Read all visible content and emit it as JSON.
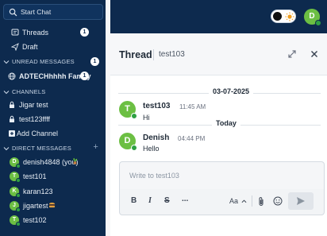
{
  "sidebar": {
    "search_placeholder": "Start Chat",
    "threads": {
      "label": "Threads",
      "badge": "1"
    },
    "draft": {
      "label": "Draft"
    },
    "unread_section": {
      "label": "UNREAD MESSAGES",
      "badge": "1"
    },
    "unread_items": [
      {
        "label": "ADTECHhhhh Family",
        "badge": "1"
      }
    ],
    "channels_section": {
      "label": "CHANNELS"
    },
    "channels": [
      {
        "label": "Jigar test"
      },
      {
        "label": "test123ffff"
      }
    ],
    "add_channel_label": "Add Channel",
    "dm_section": {
      "label": "DIRECT MESSAGES",
      "add": "+"
    },
    "direct_messages": [
      {
        "initial": "D",
        "label": "denish4848 (you)"
      },
      {
        "initial": "T",
        "label": "test101"
      },
      {
        "initial": "K",
        "label": "karan123"
      },
      {
        "initial": "J",
        "label": "jigartest"
      },
      {
        "initial": "T",
        "label": "test102"
      }
    ]
  },
  "header": {
    "user_initial": "D"
  },
  "thread": {
    "title": "Thread",
    "channel": "test103",
    "date_divider_1": "03-07-2025",
    "date_divider_2": "Today",
    "messages": [
      {
        "initial": "T",
        "name": "test103",
        "time": "11:45 AM",
        "text": "Hi"
      },
      {
        "initial": "D",
        "name": "Denish",
        "time": "04:44 PM",
        "text": "Hello"
      }
    ],
    "composer_placeholder": "Write to test103",
    "toolbar": {
      "bold": "B",
      "italic": "I",
      "strike": "S",
      "more": "...",
      "font": "Aa"
    }
  },
  "colors": {
    "sidebar_bg": "#0d2a4e",
    "avatar_green": "#6cbf43",
    "status_green": "#2ea043"
  }
}
